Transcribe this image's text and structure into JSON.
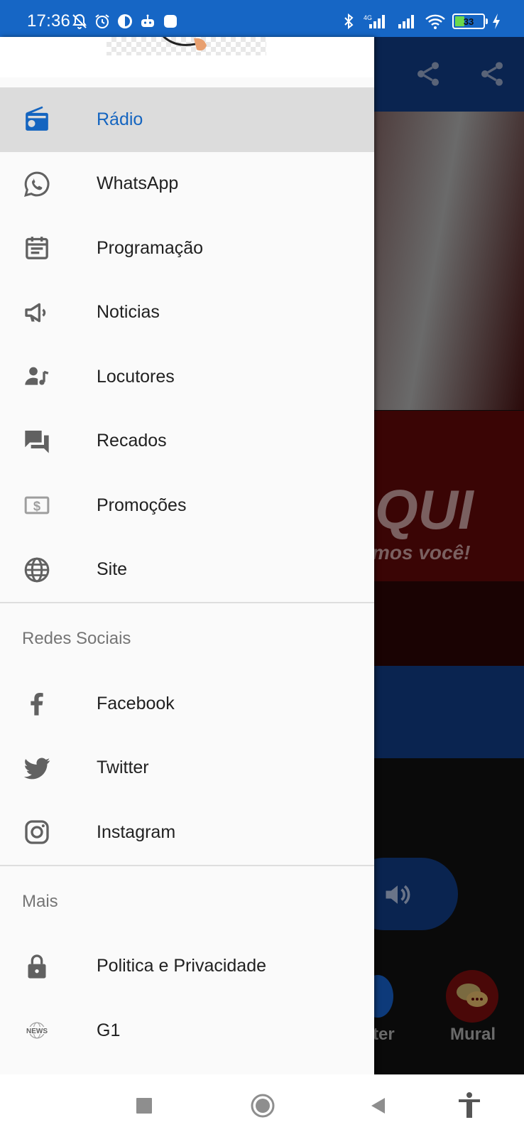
{
  "status_bar": {
    "time": "17:36",
    "battery_level": "33",
    "left_icons": [
      "mute-bell-icon",
      "alarm-icon",
      "app-icon",
      "robot-icon",
      "square-app-icon"
    ],
    "right_icons": [
      "bluetooth-icon",
      "signal-icon",
      "signal-icon",
      "wifi-icon",
      "battery-icon",
      "charging-icon"
    ]
  },
  "colors": {
    "status_bar": "#1666c5",
    "accent": "#1565c0",
    "active_item_bg": "#dcdcdc",
    "drawer_bg": "#fafafa",
    "item_text": "#212121",
    "section_text": "#757575"
  },
  "drawer": {
    "main_items": [
      {
        "label": "Rádio",
        "icon": "radio-icon",
        "active": true
      },
      {
        "label": "WhatsApp",
        "icon": "whatsapp-icon"
      },
      {
        "label": "Programação",
        "icon": "calendar-icon"
      },
      {
        "label": "Noticias",
        "icon": "megaphone-icon"
      },
      {
        "label": "Locutores",
        "icon": "person-music-icon"
      },
      {
        "label": "Recados",
        "icon": "chat-icon"
      },
      {
        "label": "Promoções",
        "icon": "dollar-bill-icon"
      },
      {
        "label": "Site",
        "icon": "globe-icon"
      }
    ],
    "social_header": "Redes Sociais",
    "social_items": [
      {
        "label": "Facebook",
        "icon": "facebook-icon"
      },
      {
        "label": "Twitter",
        "icon": "twitter-icon"
      },
      {
        "label": "Instagram",
        "icon": "instagram-icon"
      }
    ],
    "more_header": "Mais",
    "more_items": [
      {
        "label": "Politica e Privacidade",
        "icon": "lock-icon"
      },
      {
        "label": "G1",
        "icon": "news-icon",
        "icon_text": "NEWS"
      }
    ]
  },
  "background_app": {
    "banner_big": "QUI",
    "banner_small": "mos você!",
    "bottom_tab_partial": "ter",
    "bottom_tab_mural": "Mural"
  },
  "navbar": {
    "buttons": [
      "recents-button",
      "home-button",
      "back-button",
      "accessibility-button"
    ]
  }
}
